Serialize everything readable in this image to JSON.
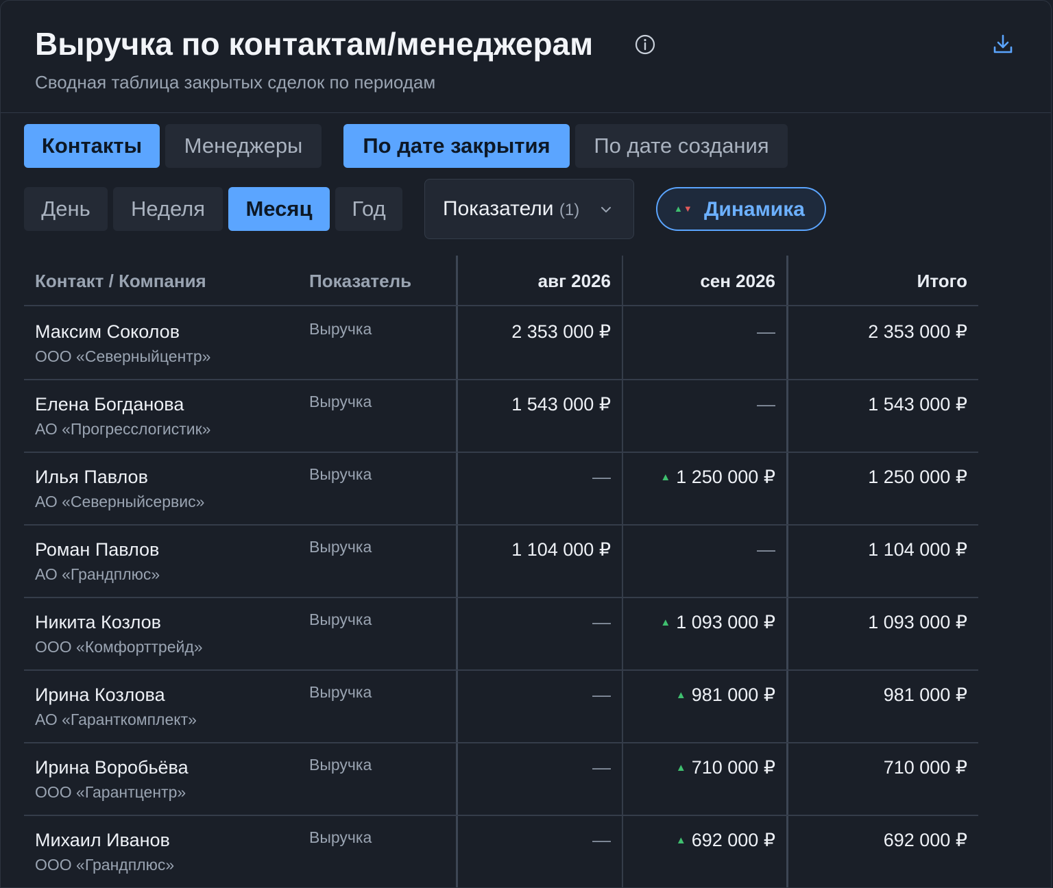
{
  "header": {
    "title": "Выручка по контактам/менеджерам",
    "subtitle": "Сводная таблица закрытых сделок по периодам",
    "info_icon": "info-circle-icon",
    "download_icon": "download-icon"
  },
  "toggles": {
    "entity": [
      {
        "label": "Контакты",
        "active": true
      },
      {
        "label": "Менеджеры",
        "active": false
      }
    ],
    "date_basis": [
      {
        "label": "По дате закрытия",
        "active": true
      },
      {
        "label": "По дате создания",
        "active": false
      }
    ],
    "period": [
      {
        "label": "День",
        "active": false
      },
      {
        "label": "Неделя",
        "active": false
      },
      {
        "label": "Месяц",
        "active": true
      },
      {
        "label": "Год",
        "active": false
      }
    ]
  },
  "metrics_dropdown": {
    "label": "Показатели",
    "count": "(1)",
    "icon": "chevron-down-icon"
  },
  "dynamics": {
    "label": "Динамика",
    "icon": "up-down-arrows-icon",
    "active": true
  },
  "colors": {
    "accent": "#5ba5ff",
    "up": "#3fbf6f",
    "down": "#e05a5a",
    "background": "#1a1f28"
  },
  "table": {
    "columns": [
      "Контакт / Компания",
      "Показатель",
      "авг 2026",
      "сен 2026",
      "Итого"
    ],
    "rows": [
      {
        "name": "Максим Соколов",
        "company": "ООО «Северныйцентр»",
        "metric": "Выручка",
        "aug": "2 353 000 ₽",
        "sep": "—",
        "sep_up": false,
        "total": "2 353 000 ₽"
      },
      {
        "name": "Елена Богданова",
        "company": "АО «Прогресслогистик»",
        "metric": "Выручка",
        "aug": "1 543 000 ₽",
        "sep": "—",
        "sep_up": false,
        "total": "1 543 000 ₽"
      },
      {
        "name": "Илья Павлов",
        "company": "АО «Северныйсервис»",
        "metric": "Выручка",
        "aug": "—",
        "sep": "1 250 000 ₽",
        "sep_up": true,
        "total": "1 250 000 ₽"
      },
      {
        "name": "Роман Павлов",
        "company": "АО «Грандплюс»",
        "metric": "Выручка",
        "aug": "1 104 000 ₽",
        "sep": "—",
        "sep_up": false,
        "total": "1 104 000 ₽"
      },
      {
        "name": "Никита Козлов",
        "company": "ООО «Комфорттрейд»",
        "metric": "Выручка",
        "aug": "—",
        "sep": "1 093 000 ₽",
        "sep_up": true,
        "total": "1 093 000 ₽"
      },
      {
        "name": "Ирина Козлова",
        "company": "АО «Гаранткомплект»",
        "metric": "Выручка",
        "aug": "—",
        "sep": "981 000 ₽",
        "sep_up": true,
        "total": "981 000 ₽"
      },
      {
        "name": "Ирина Воробьёва",
        "company": "ООО «Гарантцентр»",
        "metric": "Выручка",
        "aug": "—",
        "sep": "710 000 ₽",
        "sep_up": true,
        "total": "710 000 ₽"
      },
      {
        "name": "Михаил Иванов",
        "company": "ООО «Грандплюс»",
        "metric": "Выручка",
        "aug": "—",
        "sep": "692 000 ₽",
        "sep_up": true,
        "total": "692 000 ₽"
      }
    ]
  }
}
